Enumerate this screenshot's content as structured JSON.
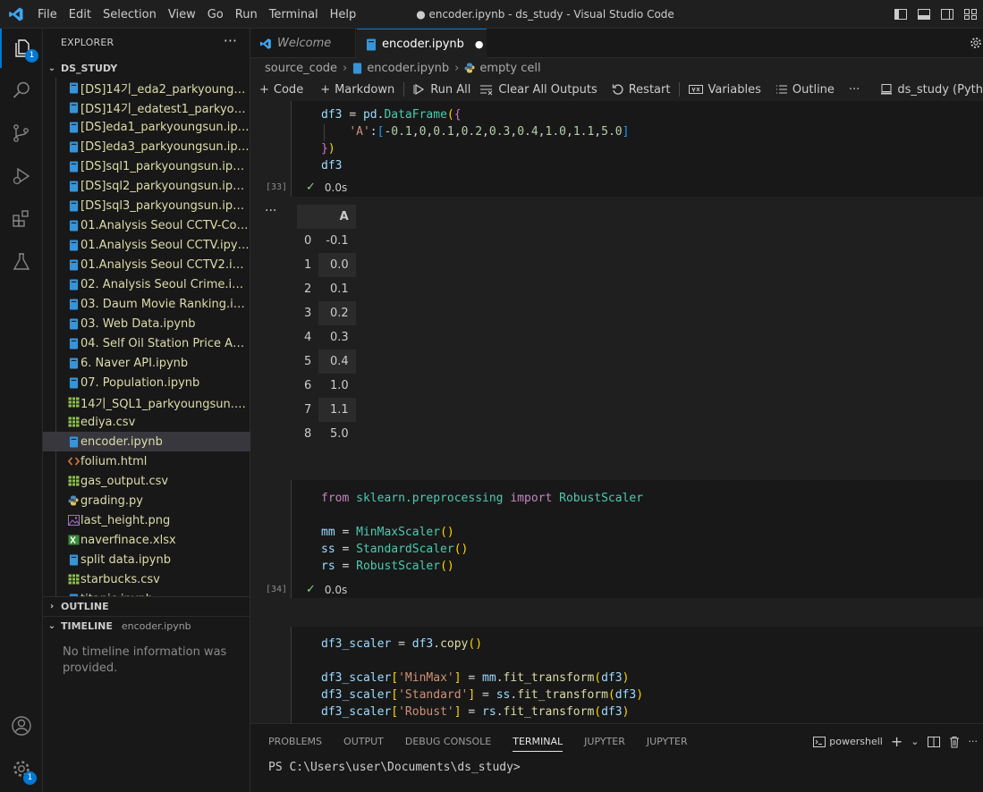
{
  "window": {
    "title": "● encoder.ipynb - ds_study - Visual Studio Code",
    "menus": [
      "File",
      "Edit",
      "Selection",
      "View",
      "Go",
      "Run",
      "Terminal",
      "Help"
    ]
  },
  "activity_bar": {
    "explorer_badge": "1",
    "settings_badge": "1"
  },
  "explorer": {
    "header": "EXPLORER",
    "more": "···",
    "folder": "DS_STUDY",
    "files": [
      {
        "name": "[DS]14기_eda2_parkyoungsun.i...",
        "icon": "notebook-icon"
      },
      {
        "name": "[DS]14기_edatest1_parkyoungs...",
        "icon": "notebook-icon"
      },
      {
        "name": "[DS]eda1_parkyoungsun.ipynb",
        "icon": "notebook-icon"
      },
      {
        "name": "[DS]eda3_parkyoungsun.ipynb",
        "icon": "notebook-icon"
      },
      {
        "name": "[DS]sql1_parkyoungsun.ipynb",
        "icon": "notebook-icon"
      },
      {
        "name": "[DS]sql2_parkyoungsun.ipynb",
        "icon": "notebook-icon"
      },
      {
        "name": "[DS]sql3_parkyoungsun.ipynb",
        "icon": "notebook-icon"
      },
      {
        "name": "01.Analysis Seoul CCTV-Copy1....",
        "icon": "notebook-icon"
      },
      {
        "name": "01.Analysis Seoul CCTV.ipynb",
        "icon": "notebook-icon"
      },
      {
        "name": "01.Analysis Seoul CCTV2.ipynb",
        "icon": "notebook-icon"
      },
      {
        "name": "02. Analysis Seoul Crime.ipynb",
        "icon": "notebook-icon"
      },
      {
        "name": "03. Daum Movie Ranking.ipynb",
        "icon": "notebook-icon"
      },
      {
        "name": "03. Web Data.ipynb",
        "icon": "notebook-icon"
      },
      {
        "name": "04. Self Oil Station Price Analys...",
        "icon": "notebook-icon"
      },
      {
        "name": "6. Naver API.ipynb",
        "icon": "notebook-icon"
      },
      {
        "name": "07. Population.ipynb",
        "icon": "notebook-icon"
      },
      {
        "name": "14기_SQL1_parkyoungsun.csv.c...",
        "icon": "csv-icon"
      },
      {
        "name": "ediya.csv",
        "icon": "csv-icon"
      },
      {
        "name": "encoder.ipynb",
        "icon": "notebook-icon",
        "selected": true
      },
      {
        "name": "folium.html",
        "icon": "html-icon"
      },
      {
        "name": "gas_output.csv",
        "icon": "csv-icon"
      },
      {
        "name": "grading.py",
        "icon": "python-icon"
      },
      {
        "name": "last_height.png",
        "icon": "image-icon"
      },
      {
        "name": "naverfinace.xlsx",
        "icon": "excel-icon"
      },
      {
        "name": "split data.ipynb",
        "icon": "notebook-icon"
      },
      {
        "name": "starbucks.csv",
        "icon": "csv-icon"
      },
      {
        "name": "titanic.ipynb",
        "icon": "notebook-icon"
      }
    ],
    "outline_label": "OUTLINE",
    "timeline_label": "TIMELINE",
    "timeline_file": "encoder.ipynb",
    "timeline_empty": "No timeline information was provided."
  },
  "tabs": [
    {
      "label": "Welcome",
      "active": false
    },
    {
      "label": "encoder.ipynb",
      "active": true,
      "dirty": "●"
    }
  ],
  "breadcrumb": [
    "source_code",
    "encoder.ipynb",
    "empty cell"
  ],
  "toolbar": {
    "code": "Code",
    "markdown": "Markdown",
    "run_all": "Run All",
    "clear_all": "Clear All Outputs",
    "restart": "Restart",
    "variables": "Variables",
    "outline": "Outline",
    "more": "···",
    "kernel": "ds_study (Pyth"
  },
  "cells": {
    "cell33": {
      "exec": "[33]",
      "time": "0.0s"
    },
    "cell34": {
      "exec": "[34]",
      "time": "0.0s"
    },
    "output_more": "···"
  },
  "dataframe": {
    "header": "A",
    "rows": [
      {
        "idx": "0",
        "val": "-0.1"
      },
      {
        "idx": "1",
        "val": "0.0"
      },
      {
        "idx": "2",
        "val": "0.1"
      },
      {
        "idx": "3",
        "val": "0.2"
      },
      {
        "idx": "4",
        "val": "0.3"
      },
      {
        "idx": "5",
        "val": "0.4"
      },
      {
        "idx": "6",
        "val": "1.0"
      },
      {
        "idx": "7",
        "val": "1.1"
      },
      {
        "idx": "8",
        "val": "5.0"
      }
    ]
  },
  "panel": {
    "tabs": [
      "PROBLEMS",
      "OUTPUT",
      "DEBUG CONSOLE",
      "TERMINAL",
      "JUPYTER",
      "JUPYTER"
    ],
    "shell": "powershell",
    "prompt": "PS C:\\Users\\user\\Documents\\ds_study>"
  },
  "colors": {
    "accent": "#0078d4",
    "success": "#89d185",
    "background": "#1f1f1f"
  }
}
